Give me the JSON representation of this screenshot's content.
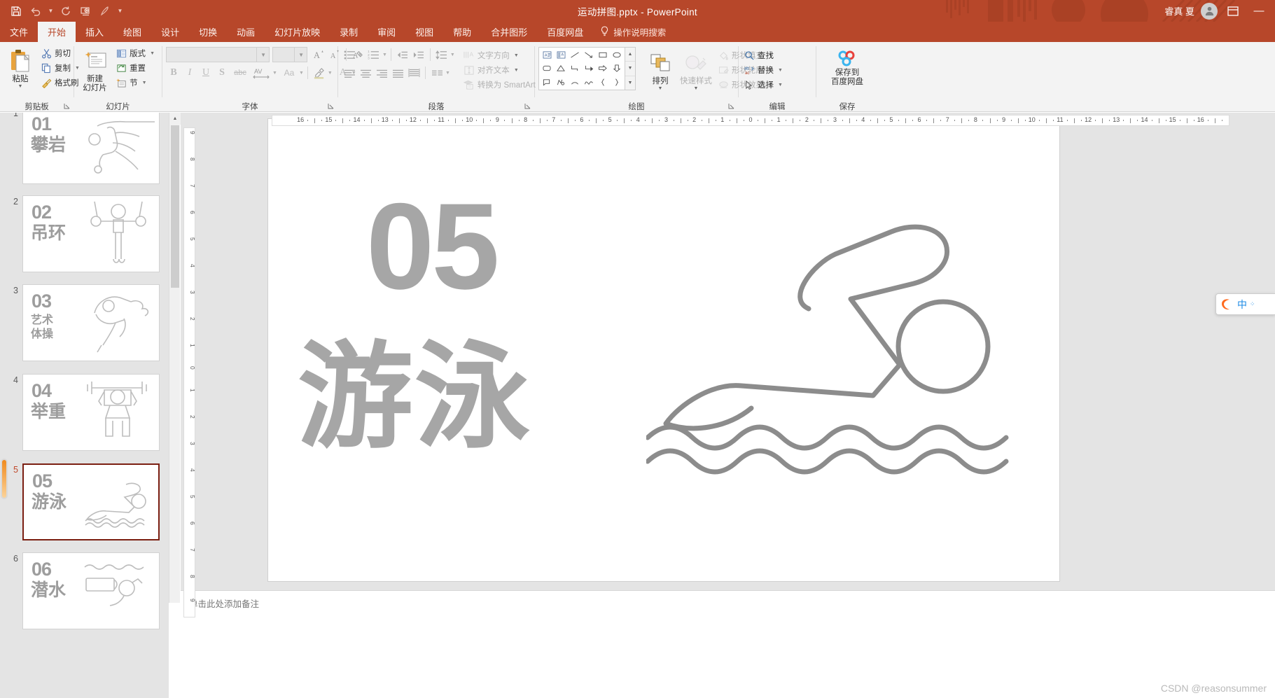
{
  "window": {
    "title": "运动拼图.pptx  -  PowerPoint",
    "user_name": "睿真 夏",
    "minimize_label": "—",
    "ribbon_display_icon": "ribbon-display-options-icon",
    "avatar_icon": "user-avatar-icon"
  },
  "quick_access": {
    "items": [
      {
        "name": "save",
        "icon": "save-icon"
      },
      {
        "name": "undo",
        "icon": "undo-icon",
        "has_caret": true
      },
      {
        "name": "redo",
        "icon": "redo-icon"
      },
      {
        "name": "start-from-beginning",
        "icon": "slideshow-icon"
      },
      {
        "name": "format-painter-qat",
        "icon": "pen-icon"
      },
      {
        "name": "customize",
        "icon": "chevron-down-icon"
      }
    ]
  },
  "tabs": [
    {
      "label": "文件",
      "active": false,
      "name": "tab-file"
    },
    {
      "label": "开始",
      "active": true,
      "name": "tab-home"
    },
    {
      "label": "插入",
      "active": false,
      "name": "tab-insert"
    },
    {
      "label": "绘图",
      "active": false,
      "name": "tab-draw"
    },
    {
      "label": "设计",
      "active": false,
      "name": "tab-design"
    },
    {
      "label": "切换",
      "active": false,
      "name": "tab-transitions"
    },
    {
      "label": "动画",
      "active": false,
      "name": "tab-animations"
    },
    {
      "label": "幻灯片放映",
      "active": false,
      "name": "tab-slideshow"
    },
    {
      "label": "录制",
      "active": false,
      "name": "tab-record"
    },
    {
      "label": "审阅",
      "active": false,
      "name": "tab-review"
    },
    {
      "label": "视图",
      "active": false,
      "name": "tab-view"
    },
    {
      "label": "帮助",
      "active": false,
      "name": "tab-help"
    },
    {
      "label": "合并图形",
      "active": false,
      "name": "tab-merge-shapes"
    },
    {
      "label": "百度网盘",
      "active": false,
      "name": "tab-baidu-netdisk"
    }
  ],
  "tell_me": {
    "label": "操作说明搜索",
    "icon": "lightbulb-icon"
  },
  "ribbon": {
    "clipboard": {
      "group_label": "剪贴板",
      "paste_label": "粘贴",
      "cut_label": "剪切",
      "copy_label": "复制",
      "format_painter_label": "格式刷"
    },
    "slides": {
      "group_label": "幻灯片",
      "new_slide_label_1": "新建",
      "new_slide_label_2": "幻灯片",
      "layout_label": "版式",
      "reset_label": "重置",
      "section_label": "节"
    },
    "font": {
      "group_label": "字体",
      "font_name_value": "",
      "font_size_value": "",
      "bold": "B",
      "italic": "I",
      "underline": "U",
      "shadow": "S",
      "strikethrough": "abc",
      "char_spacing": "AV",
      "change_case": "Aa",
      "grow_font": "A",
      "shrink_font": "A",
      "clear_formatting": "clear-format-icon",
      "text_highlight": "text-highlight-icon",
      "font_color": "A"
    },
    "paragraph": {
      "group_label": "段落",
      "text_direction_label": "文字方向",
      "align_text_label": "对齐文本",
      "smartart_label": "转换为 SmartArt"
    },
    "drawing": {
      "group_label": "绘图",
      "arrange_label": "排列",
      "quick_styles_label": "快速样式",
      "shape_fill_label": "形状填充",
      "shape_outline_label": "形状轮廓",
      "shape_effects_label": "形状效果"
    },
    "editing": {
      "group_label": "编辑",
      "find_label": "查找",
      "replace_label": "替换",
      "select_label": "选择"
    },
    "save_group": {
      "group_label": "保存",
      "button_label_1": "保存到",
      "button_label_2": "百度网盘",
      "icon": "baidu-netdisk-icon"
    }
  },
  "slides_panel": {
    "slides": [
      {
        "number": "1",
        "num_text": "01",
        "title": "攀岩",
        "title_lines": [
          "攀岩"
        ],
        "art": "climbing",
        "selected": false
      },
      {
        "number": "2",
        "num_text": "02",
        "title": "吊环",
        "title_lines": [
          "吊环"
        ],
        "art": "rings",
        "selected": false
      },
      {
        "number": "3",
        "num_text": "03",
        "title": "艺术体操",
        "title_lines": [
          "艺术",
          "体操"
        ],
        "art": "gymnastics",
        "selected": false
      },
      {
        "number": "4",
        "num_text": "04",
        "title": "举重",
        "title_lines": [
          "举重"
        ],
        "art": "weightlifting",
        "selected": false
      },
      {
        "number": "5",
        "num_text": "05",
        "title": "游泳",
        "title_lines": [
          "游泳"
        ],
        "art": "swimming",
        "selected": true
      },
      {
        "number": "6",
        "num_text": "06",
        "title": "潜水",
        "title_lines": [
          "潜水"
        ],
        "art": "diving",
        "selected": false
      }
    ]
  },
  "current_slide": {
    "number_text": "05",
    "title_text": "游泳",
    "art": "swimming",
    "text_color": "#a6a6a6",
    "art_color": "#8c8c8c"
  },
  "rulers": {
    "horizontal_ticks": [
      "16",
      "15",
      "14",
      "13",
      "12",
      "11",
      "10",
      "9",
      "8",
      "7",
      "6",
      "5",
      "4",
      "3",
      "2",
      "1",
      "0",
      "1",
      "2",
      "3",
      "4",
      "5",
      "6",
      "7",
      "8",
      "9",
      "10",
      "11",
      "12",
      "13",
      "14",
      "15",
      "16"
    ],
    "vertical_ticks": [
      "9",
      "8",
      "7",
      "6",
      "5",
      "4",
      "3",
      "2",
      "1",
      "0",
      "1",
      "2",
      "3",
      "4",
      "5",
      "6",
      "7",
      "8",
      "9"
    ]
  },
  "notes": {
    "placeholder": "单击此处添加备注"
  },
  "ime": {
    "mode": "中",
    "logo": "sogou-ime-icon"
  },
  "watermark": {
    "text": "CSDN @reasonsummer"
  },
  "colors": {
    "accent": "#b7472a",
    "ribbon_bg": "#f3f3f3",
    "panel_bg": "#e4e4e4",
    "selection_border": "#7b1f12",
    "slide_text_gray": "#a6a6a6"
  }
}
